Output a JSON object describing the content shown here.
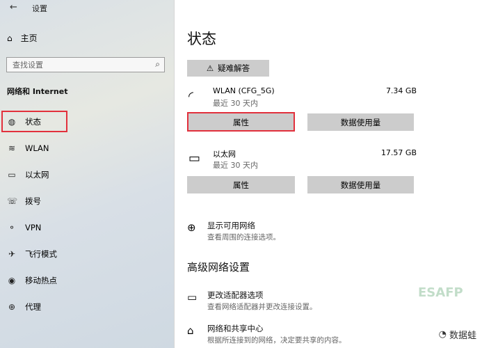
{
  "window": {
    "back_glyph": "←",
    "title": "设置"
  },
  "sidebar": {
    "home_label": "主页",
    "search_placeholder": "查找设置",
    "section_title": "网络和 Internet",
    "items": [
      {
        "label": "状态",
        "icon": "globe-icon"
      },
      {
        "label": "WLAN",
        "icon": "wifi-icon"
      },
      {
        "label": "以太网",
        "icon": "ethernet-icon"
      },
      {
        "label": "拨号",
        "icon": "dialup-icon"
      },
      {
        "label": "VPN",
        "icon": "vpn-icon"
      },
      {
        "label": "飞行模式",
        "icon": "airplane-icon"
      },
      {
        "label": "移动热点",
        "icon": "hotspot-icon"
      },
      {
        "label": "代理",
        "icon": "proxy-globe-icon"
      }
    ]
  },
  "main": {
    "title": "状态",
    "troubleshoot_label": "疑难解答",
    "networks": [
      {
        "name": "WLAN (CFG_5G)",
        "sub": "最近 30 天内",
        "size": "7.34 GB",
        "btn_props": "属性",
        "btn_usage": "数据使用量"
      },
      {
        "name": "以太网",
        "sub": "最近 30 天内",
        "size": "17.57 GB",
        "btn_props": "属性",
        "btn_usage": "数据使用量"
      }
    ],
    "show_networks": {
      "title": "显示可用网络",
      "desc": "查看周围的连接选项。"
    },
    "advanced_title": "高级网络设置",
    "adapter": {
      "title": "更改适配器选项",
      "desc": "查看网络适配器并更改连接设置。"
    },
    "sharing": {
      "title": "网络和共享中心",
      "desc": "根据所连接到的网络，决定要共享的内容。"
    }
  },
  "watermark": "ESAFP",
  "brand": "数据蛙",
  "colors": {
    "highlight": "#e2303c",
    "button_bg": "#cccccc"
  }
}
